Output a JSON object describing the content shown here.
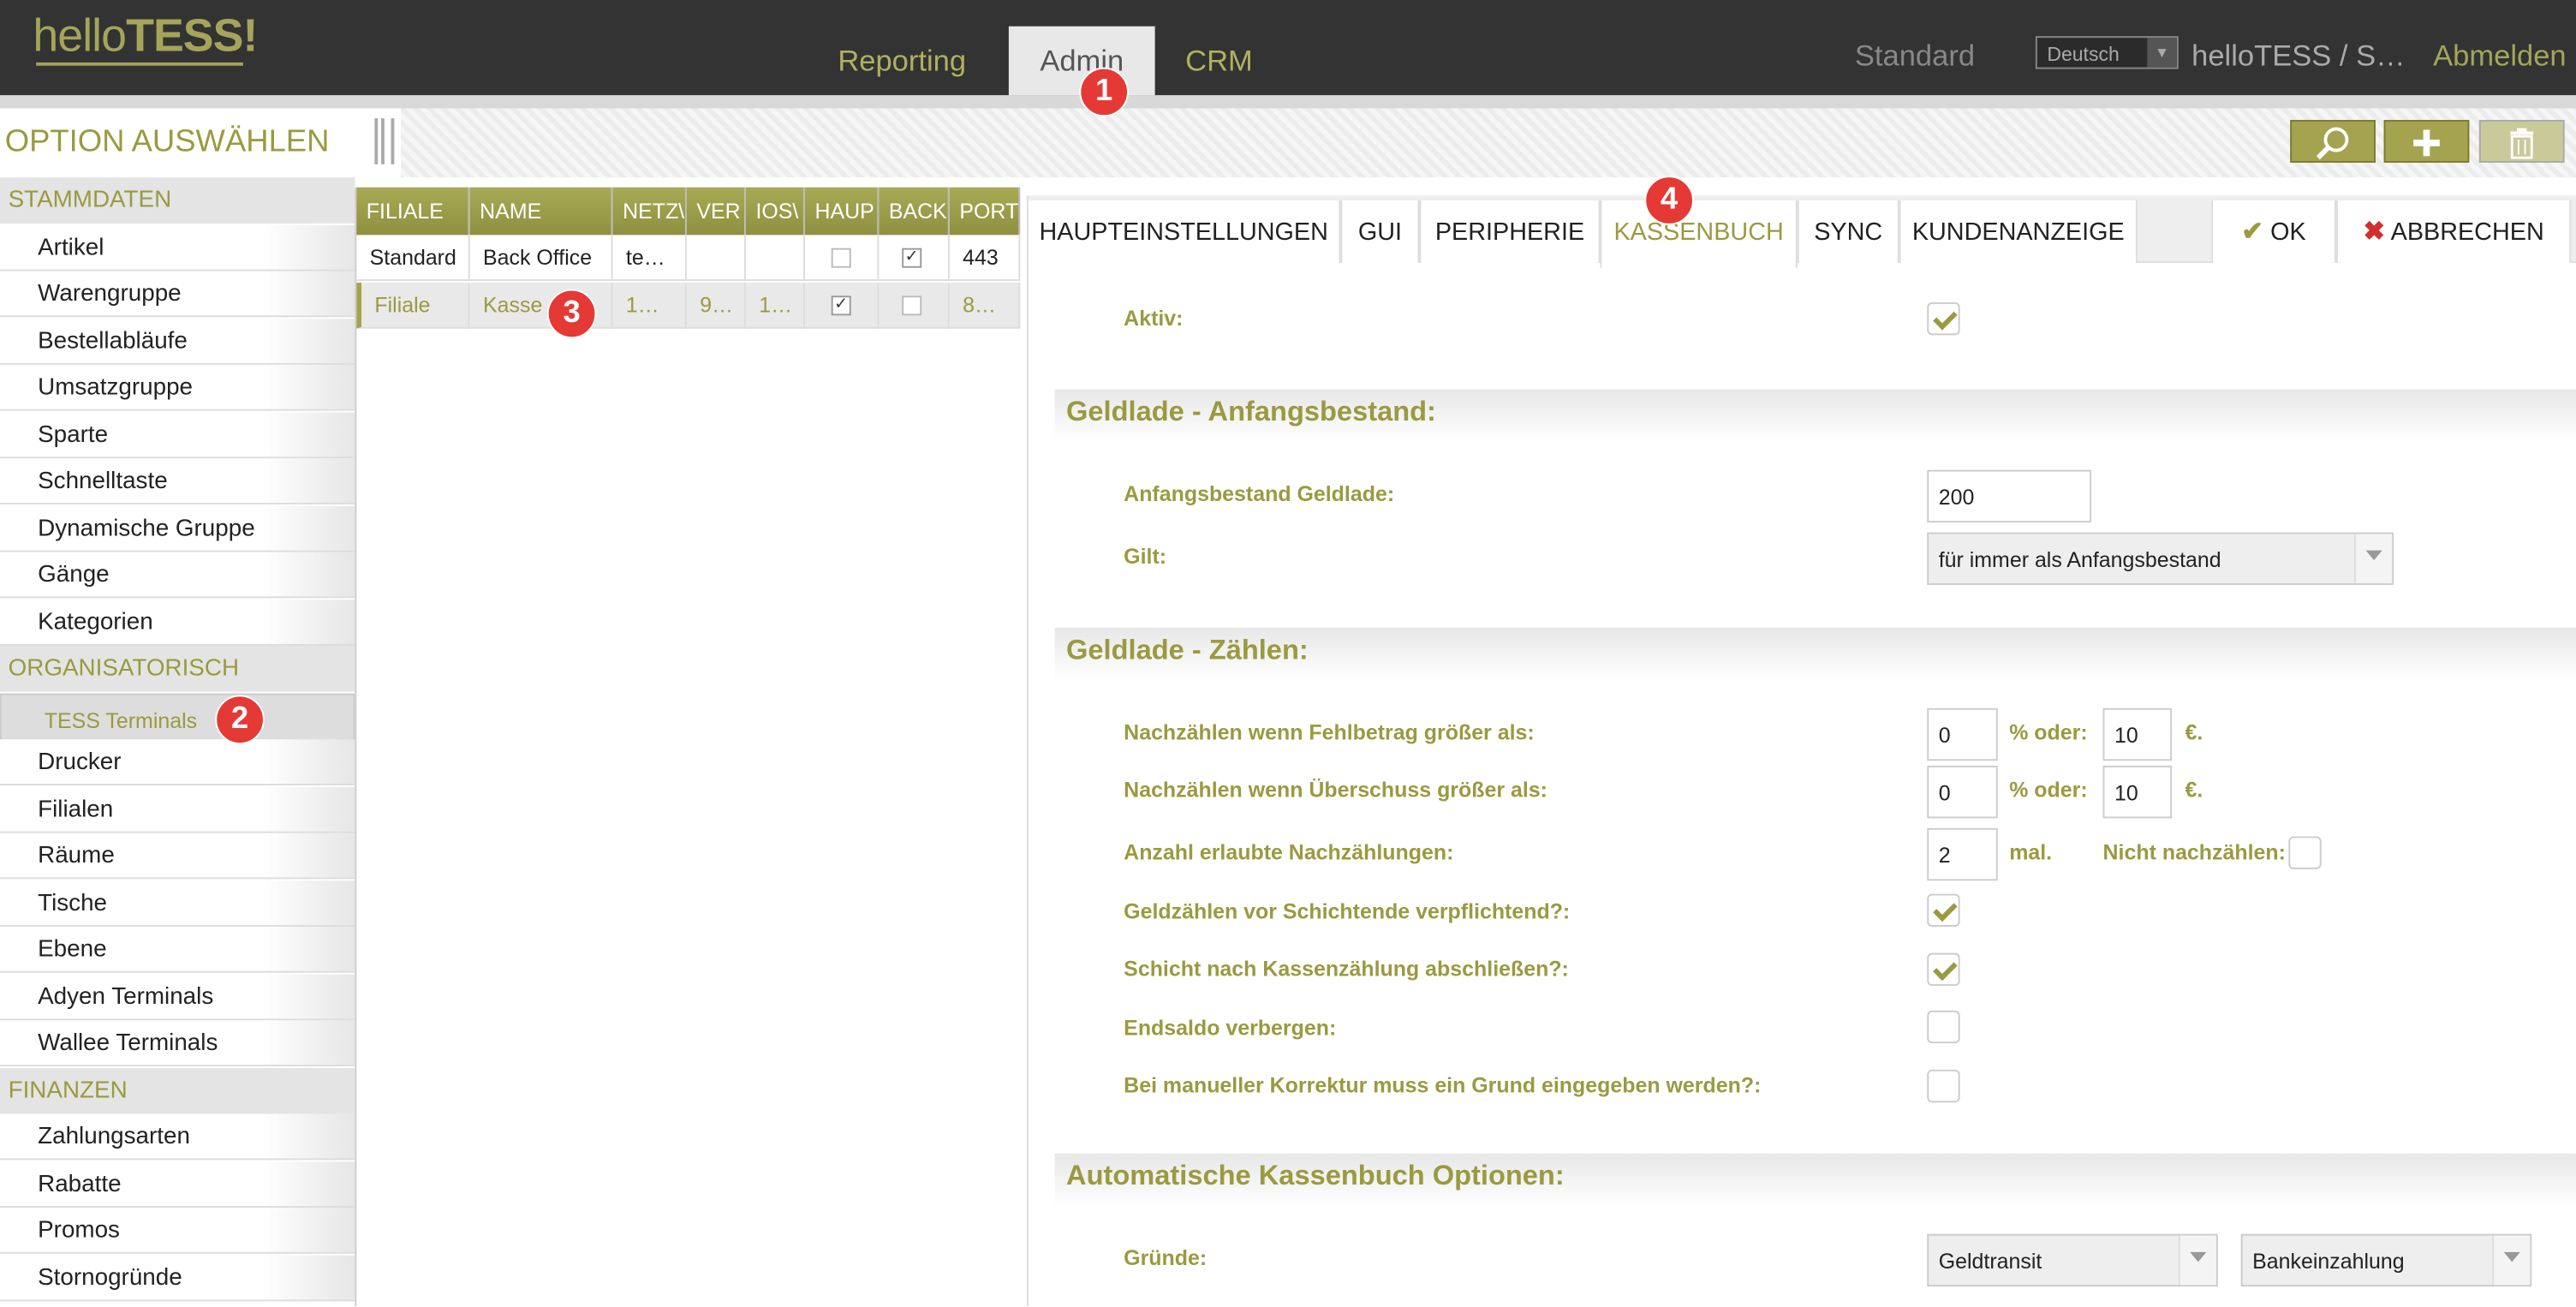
{
  "header": {
    "logo_hello": "hello",
    "logo_tess": "TESS!",
    "tabs": [
      "Reporting",
      "Admin",
      "CRM"
    ],
    "mode": "Standard",
    "language": "Deutsch",
    "account": "helloTESS / S…",
    "logout": "Abmelden"
  },
  "toolbar": {
    "title": "OPTION AUSWÄHLEN",
    "search_icon": "magnifier-icon",
    "add_icon": "plus-icon",
    "delete_icon": "trash-icon"
  },
  "sidebar": {
    "sections": [
      {
        "title": "STAMMDATEN",
        "items": [
          "Artikel",
          "Warengruppe",
          "Bestellabläufe",
          "Umsatzgruppe",
          "Sparte",
          "Schnelltaste",
          "Dynamische Gruppe",
          "Gänge",
          "Kategorien"
        ]
      },
      {
        "title": "ORGANISATORISCH",
        "items": [
          "TESS Terminals",
          "Drucker",
          "Filialen",
          "Räume",
          "Tische",
          "Ebene",
          "Adyen Terminals",
          "Wallee Terminals"
        ]
      },
      {
        "title": "FINANZEN",
        "items": [
          "Zahlungsarten",
          "Rabatte",
          "Promos",
          "Stornogründe"
        ]
      }
    ],
    "selected": "TESS Terminals"
  },
  "grid": {
    "columns": [
      "FILIALE",
      "NAME",
      "NETZ\\",
      "VER",
      "IOS\\",
      "HAUP",
      "BACK",
      "PORT"
    ],
    "rows": [
      {
        "filiale": "Standard",
        "name": "Back Office",
        "netz": "te…",
        "ver": "",
        "ios": "",
        "haup": false,
        "back": true,
        "port": "443"
      },
      {
        "filiale": "Filiale",
        "name": "Kasse",
        "netz": "1…",
        "ver": "9…",
        "ios": "1…",
        "haup": true,
        "back": false,
        "port": "8…"
      }
    ]
  },
  "detail": {
    "tabs": [
      "HAUPTEINSTELLUNGEN",
      "GUI",
      "PERIPHERIE",
      "KASSENBUCH",
      "SYNC",
      "KUNDENANZEIGE"
    ],
    "active_tab": "KASSENBUCH",
    "ok": "OK",
    "cancel": "ABBRECHEN",
    "aktiv_label": "Aktiv:",
    "aktiv": true,
    "sec1": "Geldlade - Anfangsbestand:",
    "anfangsbestand_label": "Anfangsbestand Geldlade:",
    "anfangsbestand": "200",
    "gilt_label": "Gilt:",
    "gilt": "für immer als Anfangsbestand",
    "sec2": "Geldlade - Zählen:",
    "fehlbetrag_label": "Nachzählen wenn Fehlbetrag größer als:",
    "fehlbetrag_pct": "0",
    "fehlbetrag_eur": "10",
    "ueberschuss_label": "Nachzählen wenn Überschuss größer als:",
    "ueberschuss_pct": "0",
    "ueberschuss_eur": "10",
    "pct_oder": "% oder:",
    "euro": "€.",
    "anzahl_label": "Anzahl erlaubte Nachzählungen:",
    "anzahl": "2",
    "mal": "mal.",
    "nicht_label": "Nicht nachzählen:",
    "nicht": false,
    "geldzaehlen_label": "Geldzählen vor Schichtende verpflichtend?:",
    "geldzaehlen": true,
    "schicht_label": "Schicht nach Kassenzählung abschließen?:",
    "schicht": true,
    "endsaldo_label": "Endsaldo verbergen:",
    "endsaldo": false,
    "korrektur_label": "Bei manueller Korrektur muss ein Grund eingegeben werden?:",
    "korrektur": false,
    "sec3": "Automatische Kassenbuch Optionen:",
    "gruende_label": "Gründe:",
    "grund1": "Geldtransit",
    "grund2": "Bankeinzahlung"
  },
  "markers": [
    "1",
    "2",
    "3",
    "4"
  ],
  "colors": {
    "accent": "#9a9a40",
    "topbar": "#333333",
    "marker": "#e53935"
  }
}
